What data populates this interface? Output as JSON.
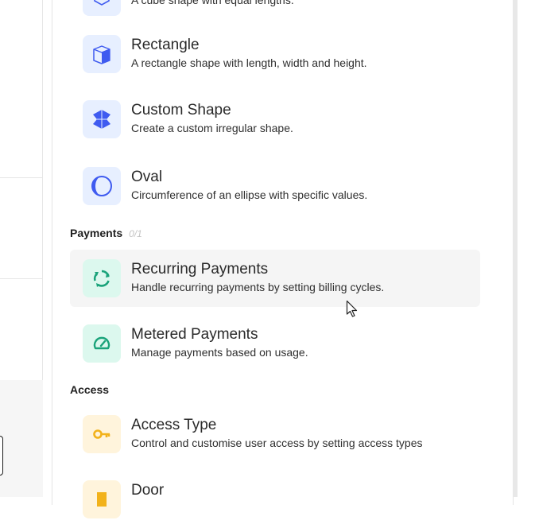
{
  "shapes": {
    "cube_desc": "A cube shape with equal lengths.",
    "items": [
      {
        "title": "Rectangle",
        "desc": "A rectangle shape with length, width and height.",
        "icon": "rectangle-box-icon"
      },
      {
        "title": "Custom Shape",
        "desc": "Create a custom irregular shape.",
        "icon": "custom-shape-icon"
      },
      {
        "title": "Oval",
        "desc": "Circumference of an ellipse with specific values.",
        "icon": "oval-icon"
      }
    ]
  },
  "payments": {
    "label": "Payments",
    "count": "0/1",
    "items": [
      {
        "title": "Recurring Payments",
        "desc": "Handle recurring payments by setting billing cycles.",
        "icon": "recurring-icon"
      },
      {
        "title": "Metered Payments",
        "desc": "Manage payments based on usage.",
        "icon": "gauge-icon"
      }
    ]
  },
  "access": {
    "label": "Access",
    "items": [
      {
        "title": "Access Type",
        "desc": "Control and customise user access by setting access types",
        "icon": "key-icon"
      },
      {
        "title": "Door",
        "desc": "",
        "icon": "door-icon"
      }
    ]
  },
  "colors": {
    "blue_icon": "#3f5bf0",
    "green_icon": "#1aa37a",
    "yellow_icon": "#f2b21b",
    "hover_bg": "#f5f5f5"
  }
}
